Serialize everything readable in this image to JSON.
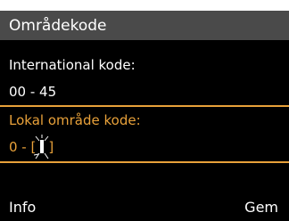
{
  "title": "Områdekode",
  "international": {
    "label": "International kode:",
    "value": "00 - 45"
  },
  "local": {
    "label": "Lokal område kode:",
    "prefix": "0 - [",
    "suffix": "]"
  },
  "softkeys": {
    "left": "Info",
    "right": "Gem"
  },
  "colors": {
    "background": "#000000",
    "title_bar": "#4a4a4a",
    "accent": "#e8a13a",
    "text": "#ffffff"
  },
  "icons": {
    "cursor": "blinking-cursor-icon"
  }
}
